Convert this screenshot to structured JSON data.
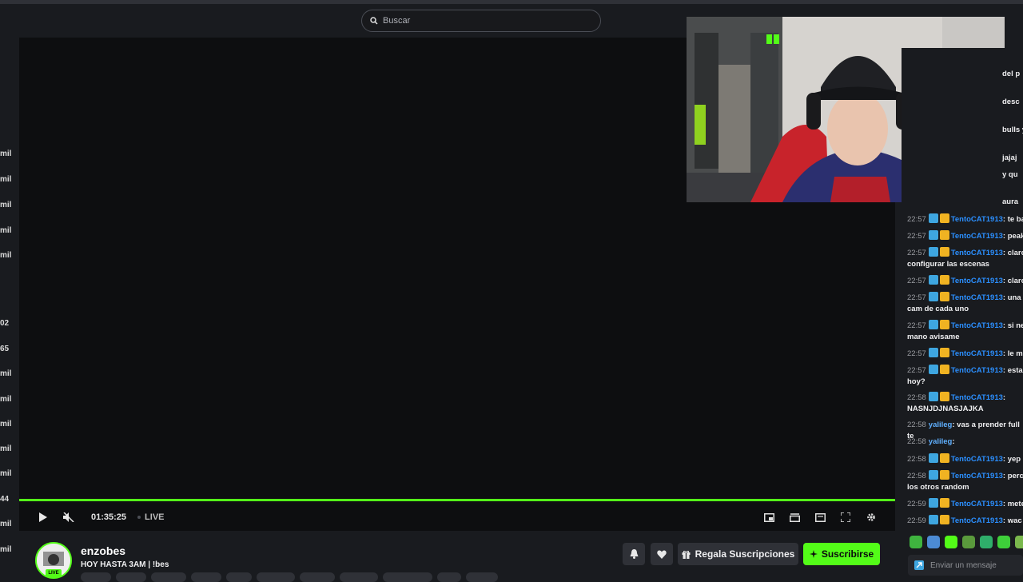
{
  "search": {
    "placeholder": "Buscar"
  },
  "left_rail": {
    "viewer_counts": [
      "mil",
      "mil",
      "mil",
      "mil",
      "mil",
      "02",
      "65",
      "mil",
      "mil",
      "mil",
      "mil",
      "mil",
      "44",
      "mil",
      "mil"
    ]
  },
  "player": {
    "time": "01:35:25",
    "live_label": "LIVE",
    "progress_fraction": 1.0
  },
  "channel": {
    "name": "enzobes",
    "title": "HOY HASTA 3AM | !bes",
    "live_badge": "LIVE"
  },
  "actions": {
    "gift_label": "Regala Suscripciones",
    "subscribe_label": "Suscribirse"
  },
  "chat": {
    "partial_messages": [
      "del p",
      "desc",
      "bulls y",
      "jajaj",
      "y qu",
      "aura"
    ],
    "messages": [
      {
        "time": "22:57",
        "user": "TentoCAT1913",
        "text": ": te ba",
        "cont": ""
      },
      {
        "time": "22:57",
        "user": "TentoCAT1913",
        "text": ": peak",
        "cont": ""
      },
      {
        "time": "22:57",
        "user": "TentoCAT1913",
        "text": ": claro",
        "cont": "configurar las escenas"
      },
      {
        "time": "22:57",
        "user": "TentoCAT1913",
        "text": ": claro",
        "cont": ""
      },
      {
        "time": "22:57",
        "user": "TentoCAT1913",
        "text": ": una",
        "cont": "cam de cada uno"
      },
      {
        "time": "22:57",
        "user": "TentoCAT1913",
        "text": ": si ne",
        "cont": "mano avisame"
      },
      {
        "time": "22:57",
        "user": "TentoCAT1913",
        "text": ": le m",
        "cont": ""
      },
      {
        "time": "22:57",
        "user": "TentoCAT1913",
        "text": ": esta",
        "cont": "hoy?"
      },
      {
        "time": "22:58",
        "user": "TentoCAT1913",
        "text": ":",
        "cont": "NASNJDJNASJAJKA"
      },
      {
        "time": "22:58",
        "user": "yalileg",
        "text": ": vas a prender full te",
        "cont": ""
      },
      {
        "time": "22:58",
        "user": "yalileg",
        "text": ":",
        "cont": ""
      },
      {
        "time": "22:58",
        "user": "TentoCAT1913",
        "text": ": yep",
        "cont": ""
      },
      {
        "time": "22:58",
        "user": "TentoCAT1913",
        "text": ": perc",
        "cont": "los otros random"
      },
      {
        "time": "22:59",
        "user": "TentoCAT1913",
        "text": ": mete",
        "cont": ""
      },
      {
        "time": "22:59",
        "user": "TentoCAT1913",
        "text": ": wac",
        "cont": ""
      }
    ],
    "input_placeholder": "Enviar un mensaje"
  },
  "colors": {
    "accent": "#53fc18",
    "background": "#191b1f",
    "username": "#2b8fff"
  }
}
